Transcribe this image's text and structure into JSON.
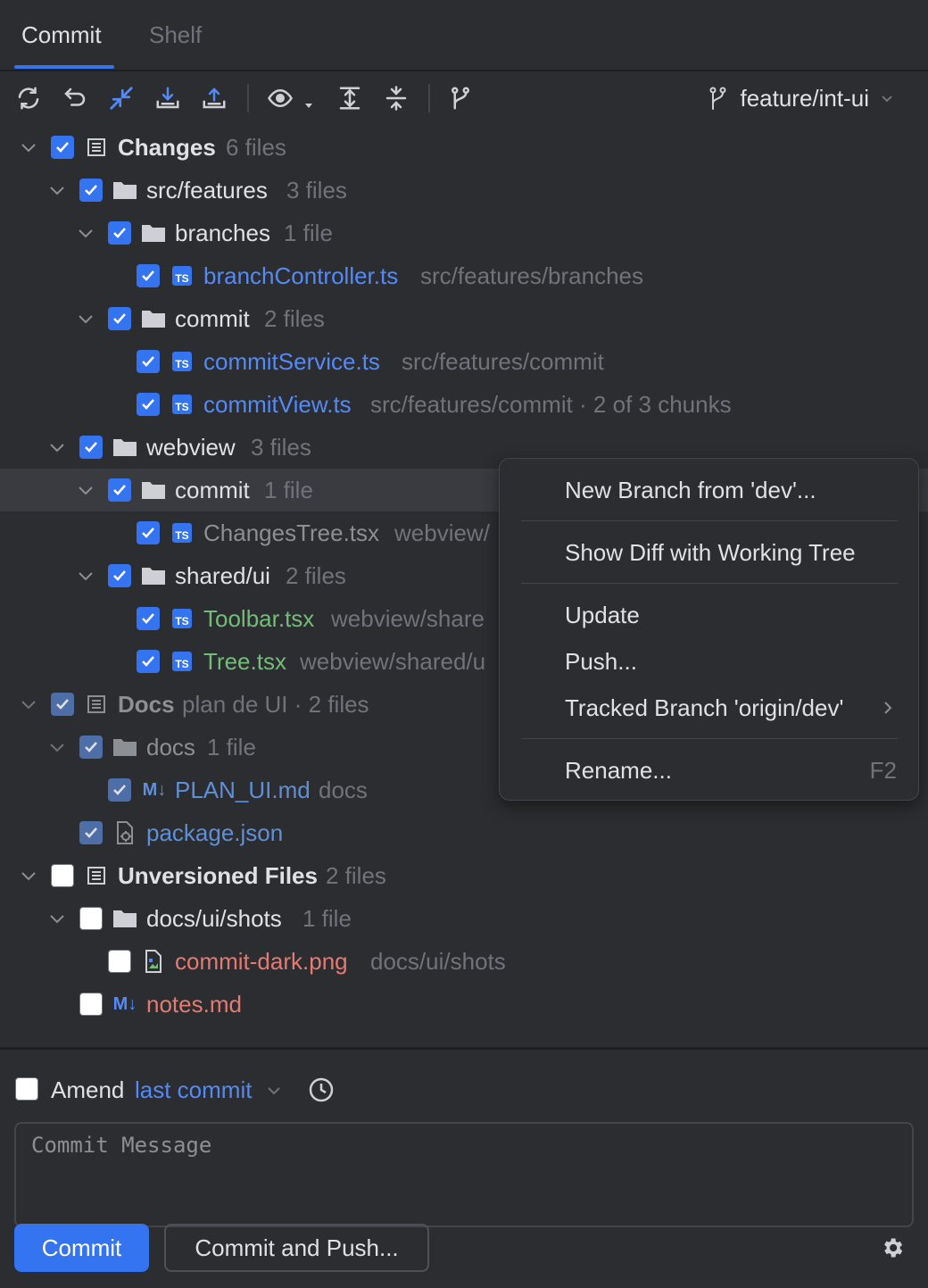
{
  "tabs": [
    {
      "label": "Commit",
      "active": true
    },
    {
      "label": "Shelf",
      "active": false
    }
  ],
  "toolbar": {
    "icons": [
      "refresh-icon",
      "rollback-icon",
      "diff-icon",
      "update-icon",
      "shelve-icon",
      "eye-icon",
      "dropdown-icon",
      "expand-all-icon",
      "collapse-all-icon",
      "branch-icon"
    ],
    "branch": "feature/int-ui"
  },
  "tree": {
    "rows": [
      {
        "label": "Changes",
        "meta": "6 files"
      },
      {
        "label": "src/features",
        "meta": "3 files"
      },
      {
        "label": "branches",
        "meta": "1 file"
      },
      {
        "label": "branchController.ts",
        "meta": "src/features/branches"
      },
      {
        "label": "commit",
        "meta": "2 files"
      },
      {
        "label": "commitService.ts",
        "meta": "src/features/commit"
      },
      {
        "label": "commitView.ts",
        "meta": "src/features/commit · 2 of 3 chunks"
      },
      {
        "label": "webview",
        "meta": "3 files"
      },
      {
        "label": "commit",
        "meta": "1 file"
      },
      {
        "label": "ChangesTree.tsx",
        "meta": "webview/"
      },
      {
        "label": "shared/ui",
        "meta": "2 files"
      },
      {
        "label": "Toolbar.tsx",
        "meta": "webview/share"
      },
      {
        "label": "Tree.tsx",
        "meta": "webview/shared/u"
      },
      {
        "label": "Docs",
        "meta": "plan de UI · 2 files"
      },
      {
        "label": "docs",
        "meta": "1 file"
      },
      {
        "label": "PLAN_UI.md",
        "meta": "docs"
      },
      {
        "label": "package.json",
        "meta": ""
      },
      {
        "label": "Unversioned Files",
        "meta": "2 files"
      },
      {
        "label": "docs/ui/shots",
        "meta": "1 file"
      },
      {
        "label": "commit-dark.png",
        "meta": "docs/ui/shots"
      },
      {
        "label": "notes.md",
        "meta": ""
      }
    ]
  },
  "context_menu": {
    "items": [
      {
        "label": "New Branch from 'dev'..."
      },
      {
        "label": "Show Diff with Working Tree"
      },
      {
        "label": "Update"
      },
      {
        "label": "Push..."
      },
      {
        "label": "Tracked Branch 'origin/dev'"
      },
      {
        "label": "Rename...",
        "shortcut": "F2"
      }
    ]
  },
  "commit_panel": {
    "amend_label": "Amend",
    "amend_link": "last commit",
    "message_placeholder": "Commit Message",
    "commit_button": "Commit",
    "commit_push_button": "Commit and Push..."
  },
  "colors": {
    "background": "#2b2d30",
    "accent": "#3574f0",
    "modified": "#548af7",
    "added": "#73bd79",
    "unversioned": "#e57a72"
  }
}
